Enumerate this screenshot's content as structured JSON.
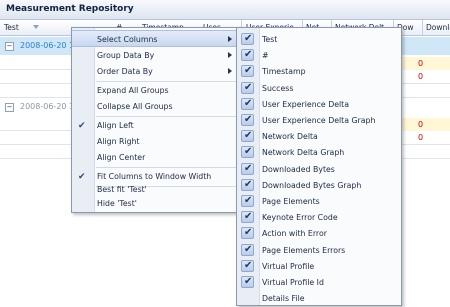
{
  "window": {
    "title": "Measurement Repository"
  },
  "columns": [
    {
      "key": "test",
      "label": "Test"
    },
    {
      "key": "num",
      "label": "#"
    },
    {
      "key": "timestamp",
      "label": "Timestamp"
    },
    {
      "key": "uses",
      "label": "Uses"
    },
    {
      "key": "ux",
      "label": "User Experie"
    },
    {
      "key": "net",
      "label": "Net"
    },
    {
      "key": "netdelta",
      "label": "Network Delt"
    },
    {
      "key": "dow",
      "label": "Dow"
    },
    {
      "key": "downl",
      "label": "Downlo"
    }
  ],
  "groups": [
    {
      "label": "2008-06-20 10",
      "selected": true
    },
    {
      "label": "2008-06-20 10",
      "selected": false
    }
  ],
  "cells": {
    "zero_1": "0",
    "zero_2": "0",
    "zero_3": "0",
    "zero_4": "0"
  },
  "context_menu": {
    "items": [
      {
        "label": "Select Columns",
        "submenu": true,
        "active": true
      },
      {
        "label": "Group Data By",
        "submenu": true
      },
      {
        "label": "Order Data By",
        "submenu": true
      },
      {
        "label": "Expand All Groups"
      },
      {
        "label": "Collapse All Groups"
      },
      {
        "label": "Align Left",
        "checked": true
      },
      {
        "label": "Align Right"
      },
      {
        "label": "Align Center"
      },
      {
        "label": "Fit Columns to Window Width",
        "checked": true
      },
      {
        "label": "Best fit 'Test'"
      },
      {
        "label": "Hide 'Test'"
      }
    ]
  },
  "columns_submenu": {
    "items": [
      {
        "label": "Test",
        "checked": true
      },
      {
        "label": "#",
        "checked": true
      },
      {
        "label": "Timestamp",
        "checked": true
      },
      {
        "label": "Success",
        "checked": true
      },
      {
        "label": "User Experience Delta",
        "checked": true
      },
      {
        "label": "User Experience Delta Graph",
        "checked": true
      },
      {
        "label": "Network Delta",
        "checked": true
      },
      {
        "label": "Network Delta Graph",
        "checked": true
      },
      {
        "label": "Downloaded Bytes",
        "checked": true
      },
      {
        "label": "Downloaded Bytes Graph",
        "checked": true
      },
      {
        "label": "Page Elements",
        "checked": true
      },
      {
        "label": "Keynote Error Code",
        "checked": true
      },
      {
        "label": "Action with Error",
        "checked": true
      },
      {
        "label": "Page Elements Errors",
        "checked": true
      },
      {
        "label": "Virtual Profile",
        "checked": true
      },
      {
        "label": "Virtual Profile Id",
        "checked": true
      },
      {
        "label": "Details File",
        "checked": false
      }
    ]
  },
  "colors": {
    "accent": "#2b7fd4",
    "selected_row": "#cfe7f7",
    "error_value": "#d40000"
  }
}
